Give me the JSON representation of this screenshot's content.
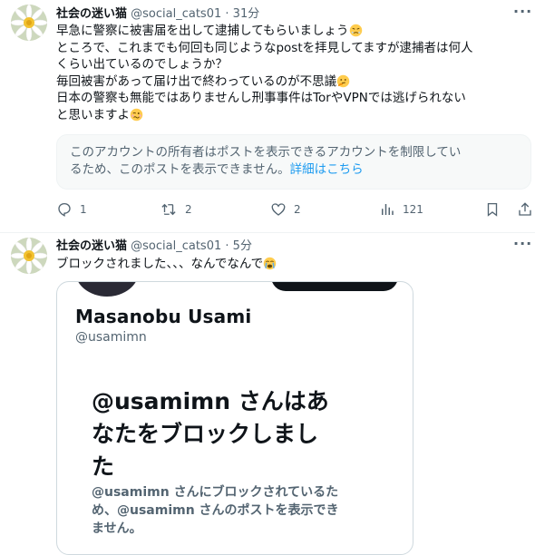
{
  "tweets": [
    {
      "display_name": "社会の迷い猫",
      "handle": "@social_cats01",
      "dot": "·",
      "time": "31分",
      "more": "···",
      "lines": [
        "早急に警察に被害届を出して逮捕してもらいましょう",
        "ところで、これまでも何回も同じようなpostを拝見してますが逮捕者は何人",
        "くらい出ているのでしょうか？",
        "毎回被害があって届け出で終わっているのが不思議",
        "日本の警察も無能ではありませんし刑事事件はTorやVPNでは逃げられない",
        "と思いますよ"
      ],
      "notice": {
        "line1": "このアカウントの所有者はポストを表示できるアカウントを制限してい",
        "line2": "るため、このポストを表示できません。",
        "link": "詳細はこちら"
      },
      "actions": {
        "replies": "1",
        "reposts": "2",
        "likes": "2",
        "views": "121"
      }
    },
    {
      "display_name": "社会の迷い猫",
      "handle": "@social_cats01",
      "dot": "·",
      "time": "5分",
      "more": "···",
      "text": "ブロックされました、、、なんでなんで",
      "card": {
        "name": "Masanobu Usami",
        "handle": "@usamimn",
        "headline1": "@usamimn さんはあ",
        "headline2": "なたをブロックしまし",
        "headline3": "た",
        "sub1": "@usamimn さんにブロックされているた",
        "sub2": "め、@usamimn さんのポストを表示でき",
        "sub3": "ません。"
      }
    }
  ],
  "icons": {
    "avatar": "daisy-flower-avatar",
    "reply": "reply-icon",
    "repost": "repost-icon",
    "like": "heart-icon",
    "views": "analytics-icon",
    "bookmark": "bookmark-icon",
    "share": "share-icon",
    "emoji1": "huffing-face-emoji",
    "emoji2": "thinking-face-emoji",
    "emoji3": "woozy-face-emoji",
    "emoji4": "crying-face-emoji"
  },
  "colors": {
    "link": "#1d9bf0",
    "secondary": "#536471",
    "text": "#0f1419"
  }
}
